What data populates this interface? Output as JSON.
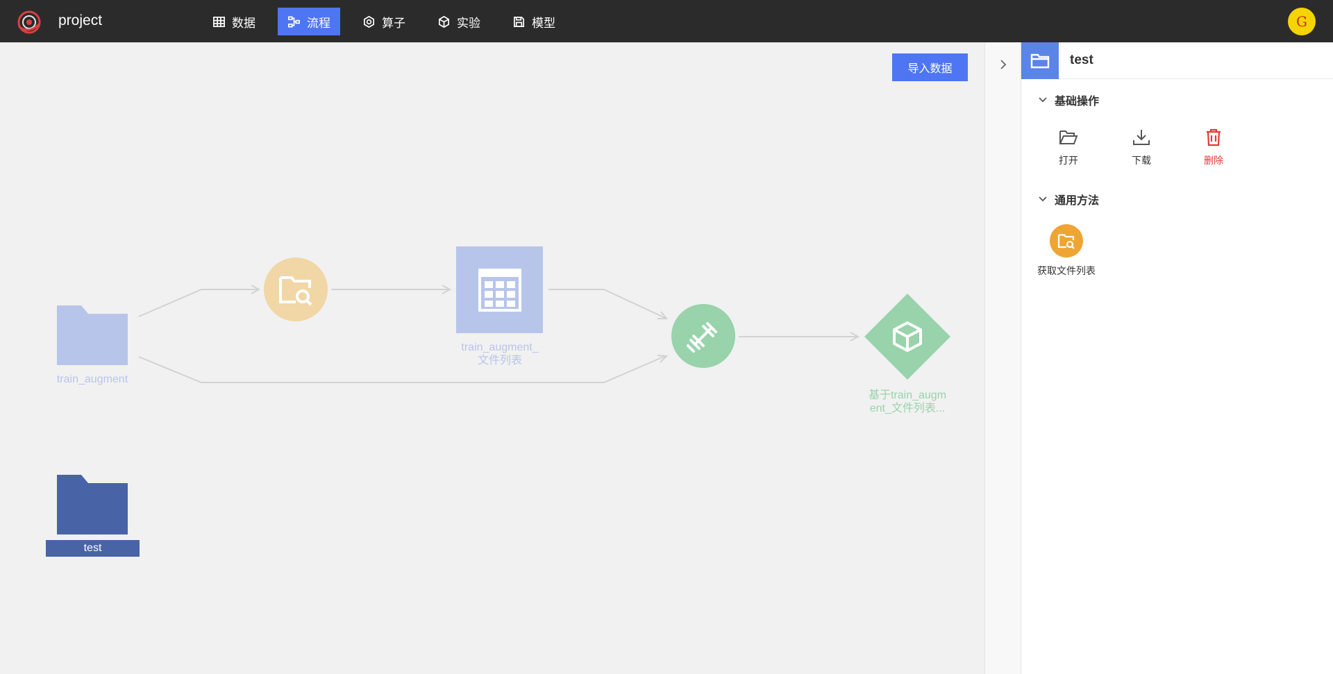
{
  "header": {
    "project_name": "project",
    "nav": [
      {
        "label": "数据",
        "icon": "table-icon"
      },
      {
        "label": "流程",
        "icon": "flow-icon",
        "active": true
      },
      {
        "label": "算子",
        "icon": "hexagon-icon"
      },
      {
        "label": "实验",
        "icon": "cube-icon"
      },
      {
        "label": "模型",
        "icon": "save-icon"
      }
    ],
    "avatar_letter": "G"
  },
  "canvas": {
    "import_button": "导入数据",
    "nodes": {
      "train_augment": {
        "label": "train_augment",
        "color": "#b8c5ea"
      },
      "file_list_method": {
        "color": "#f1d6a6"
      },
      "file_list_table": {
        "label_line1": "train_augment_",
        "label_line2": "文件列表",
        "color": "#b8c5ea"
      },
      "training": {
        "color": "#98d3ab"
      },
      "model": {
        "label_line1": "基于train_augm",
        "label_line2": "ent_文件列表...",
        "color": "#98d3ab"
      },
      "test": {
        "label": "test",
        "color": "#4963a7"
      }
    }
  },
  "panel": {
    "title": "test",
    "basic_section": "基础操作",
    "actions": [
      {
        "label": "打开",
        "icon": "folder-open-icon"
      },
      {
        "label": "下载",
        "icon": "download-icon"
      },
      {
        "label": "删除",
        "icon": "trash-icon"
      }
    ],
    "methods_section": "通用方法",
    "methods": [
      {
        "label": "获取文件列表",
        "icon": "folder-search-icon",
        "color": "#eea533"
      }
    ]
  }
}
